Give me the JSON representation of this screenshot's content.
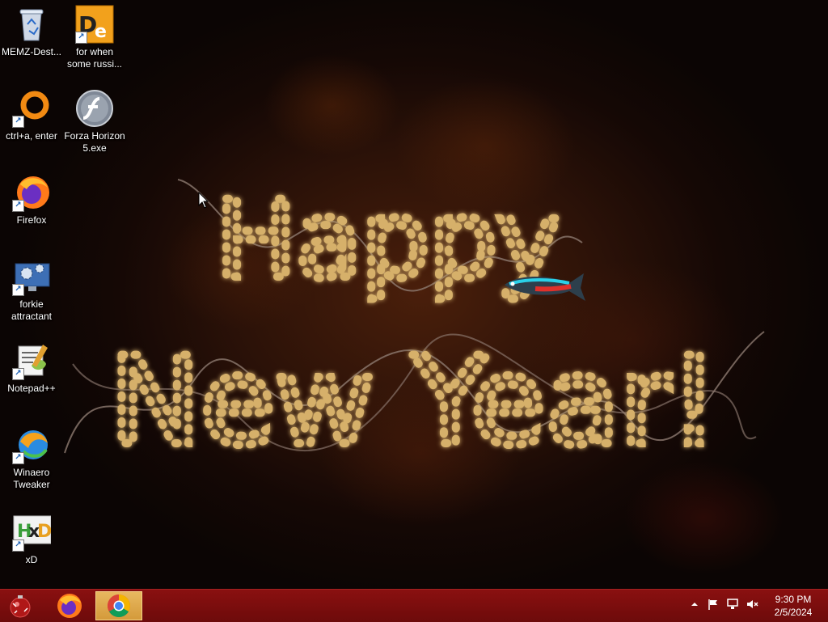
{
  "desktop": {
    "wallpaper": {
      "greeting_line1": "Happy",
      "greeting_line2": "New Year!"
    },
    "icons": [
      {
        "label": "MEMZ-Dest...",
        "icon": "recycle-bin-icon"
      },
      {
        "label": "for when some russi...",
        "icon": "dependency-walker-icon"
      },
      {
        "label": "ctrl+a, enter",
        "icon": "orange-ring-icon"
      },
      {
        "label": "Forza Horizon 5.exe",
        "icon": "flash-player-icon"
      },
      {
        "label": "Firefox",
        "icon": "firefox-icon"
      },
      {
        "label": "forkie attractant",
        "icon": "monitor-gears-icon"
      },
      {
        "label": "Notepad++",
        "icon": "notepad-plus-plus-icon"
      },
      {
        "label": "Winaero Tweaker",
        "icon": "winaero-tweaker-icon"
      },
      {
        "label": "xD",
        "icon": "hxd-icon"
      }
    ]
  },
  "taskbar": {
    "start_icon": "christmas-ornament-start-icon",
    "pinned": [
      "Firefox",
      "Google Chrome"
    ],
    "active_app": "Google Chrome",
    "tray_icons": [
      "show-hidden-icons-chevron",
      "action-center-flag-icon",
      "network-icon",
      "volume-muted-icon"
    ],
    "clock_time": "9:30 PM",
    "clock_date": "2/5/2024"
  },
  "colors": {
    "taskbar": "#7a0e0e",
    "active_task": "#dca84c",
    "bulb": "#ffe9a8",
    "tube": "#d6b06a"
  }
}
